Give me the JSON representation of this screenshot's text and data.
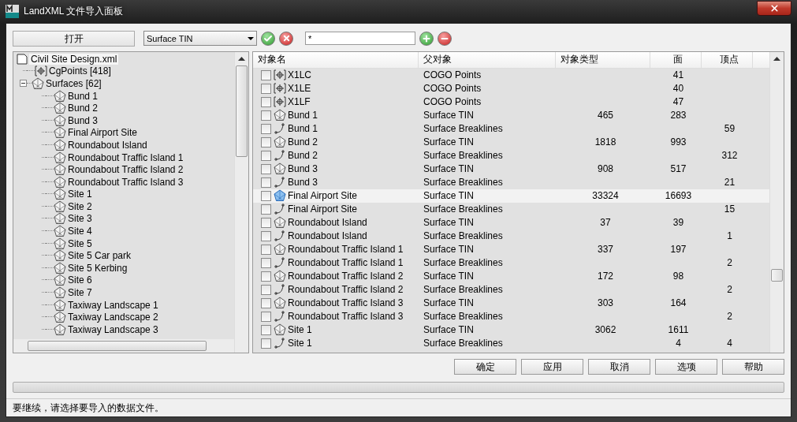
{
  "window": {
    "title": "LandXML 文件导入面板"
  },
  "toolbar": {
    "open_button": "打开",
    "filter_select": {
      "value": "Surface TIN"
    },
    "pattern_field": {
      "value": "*"
    }
  },
  "tree": [
    {
      "label": "Civil Site Design.xml",
      "kind": "file",
      "selected": true,
      "expanded": true,
      "children": [
        {
          "label": "CgPoints [418]",
          "kind": "points",
          "selected": false
        },
        {
          "label": "Surfaces [62]",
          "kind": "surface",
          "selected": false,
          "expanded": true,
          "children": [
            {
              "label": "Bund 1",
              "kind": "surface",
              "selected": false
            },
            {
              "label": "Bund 2",
              "kind": "surface",
              "selected": false
            },
            {
              "label": "Bund 3",
              "kind": "surface",
              "selected": false
            },
            {
              "label": "Final Airport Site",
              "kind": "surface",
              "selected": false
            },
            {
              "label": "Roundabout Island",
              "kind": "surface",
              "selected": false
            },
            {
              "label": "Roundabout Traffic Island 1",
              "kind": "surface",
              "selected": false
            },
            {
              "label": "Roundabout Traffic Island 2",
              "kind": "surface",
              "selected": false
            },
            {
              "label": "Roundabout Traffic Island 3",
              "kind": "surface",
              "selected": false
            },
            {
              "label": "Site 1",
              "kind": "surface",
              "selected": false
            },
            {
              "label": "Site 2",
              "kind": "surface",
              "selected": false
            },
            {
              "label": "Site 3",
              "kind": "surface",
              "selected": false
            },
            {
              "label": "Site 4",
              "kind": "surface",
              "selected": false
            },
            {
              "label": "Site 5",
              "kind": "surface",
              "selected": false
            },
            {
              "label": "Site 5 Car park",
              "kind": "surface",
              "selected": false
            },
            {
              "label": "Site 5 Kerbing",
              "kind": "surface",
              "selected": false
            },
            {
              "label": "Site 6",
              "kind": "surface",
              "selected": false
            },
            {
              "label": "Site 7",
              "kind": "surface",
              "selected": false
            },
            {
              "label": "Taxiway Landscape 1",
              "kind": "surface",
              "selected": false
            },
            {
              "label": "Taxiway Landscape 2",
              "kind": "surface",
              "selected": false
            },
            {
              "label": "Taxiway Landscape 3",
              "kind": "surface",
              "selected": false
            }
          ]
        }
      ]
    }
  ],
  "table": {
    "columns": [
      "对象名",
      "父对象",
      "对象类型",
      "面",
      "顶点"
    ],
    "rows": [
      {
        "kind": "points",
        "checked": false,
        "selected": false,
        "cells": [
          "X1LC",
          "COGO Points",
          "",
          "41",
          ""
        ]
      },
      {
        "kind": "points",
        "checked": false,
        "selected": false,
        "cells": [
          "X1LE",
          "COGO Points",
          "",
          "40",
          ""
        ]
      },
      {
        "kind": "points",
        "checked": false,
        "selected": false,
        "cells": [
          "X1LF",
          "COGO Points",
          "",
          "47",
          ""
        ]
      },
      {
        "kind": "tin",
        "checked": false,
        "selected": false,
        "cells": [
          "Bund 1",
          "Surface TIN",
          "465",
          "283",
          ""
        ]
      },
      {
        "kind": "breakline",
        "checked": false,
        "selected": false,
        "cells": [
          "Bund 1",
          "Surface Breaklines",
          "",
          "",
          "59"
        ]
      },
      {
        "kind": "tin",
        "checked": false,
        "selected": false,
        "cells": [
          "Bund 2",
          "Surface TIN",
          "1818",
          "993",
          ""
        ]
      },
      {
        "kind": "breakline",
        "checked": false,
        "selected": false,
        "cells": [
          "Bund 2",
          "Surface Breaklines",
          "",
          "",
          "312"
        ]
      },
      {
        "kind": "tin",
        "checked": false,
        "selected": false,
        "cells": [
          "Bund 3",
          "Surface TIN",
          "908",
          "517",
          ""
        ]
      },
      {
        "kind": "breakline",
        "checked": false,
        "selected": false,
        "cells": [
          "Bund 3",
          "Surface Breaklines",
          "",
          "",
          "21"
        ]
      },
      {
        "kind": "tin",
        "checked": false,
        "selected": true,
        "cells": [
          "Final Airport Site",
          "Surface TIN",
          "33324",
          "16693",
          ""
        ]
      },
      {
        "kind": "breakline",
        "checked": false,
        "selected": false,
        "cells": [
          "Final Airport Site",
          "Surface Breaklines",
          "",
          "",
          "15"
        ]
      },
      {
        "kind": "tin",
        "checked": false,
        "selected": false,
        "cells": [
          "Roundabout Island",
          "Surface TIN",
          "37",
          "39",
          ""
        ]
      },
      {
        "kind": "breakline",
        "checked": false,
        "selected": false,
        "cells": [
          "Roundabout Island",
          "Surface Breaklines",
          "",
          "",
          "1"
        ]
      },
      {
        "kind": "tin",
        "checked": false,
        "selected": false,
        "cells": [
          "Roundabout Traffic Island 1",
          "Surface TIN",
          "337",
          "197",
          ""
        ]
      },
      {
        "kind": "breakline",
        "checked": false,
        "selected": false,
        "cells": [
          "Roundabout Traffic Island 1",
          "Surface Breaklines",
          "",
          "",
          "2"
        ]
      },
      {
        "kind": "tin",
        "checked": false,
        "selected": false,
        "cells": [
          "Roundabout Traffic Island 2",
          "Surface TIN",
          "172",
          "98",
          ""
        ]
      },
      {
        "kind": "breakline",
        "checked": false,
        "selected": false,
        "cells": [
          "Roundabout Traffic Island 2",
          "Surface Breaklines",
          "",
          "",
          "2"
        ]
      },
      {
        "kind": "tin",
        "checked": false,
        "selected": false,
        "cells": [
          "Roundabout Traffic Island 3",
          "Surface TIN",
          "303",
          "164",
          ""
        ]
      },
      {
        "kind": "breakline",
        "checked": false,
        "selected": false,
        "cells": [
          "Roundabout Traffic Island 3",
          "Surface Breaklines",
          "",
          "",
          "2"
        ]
      },
      {
        "kind": "tin",
        "checked": false,
        "selected": false,
        "cells": [
          "Site 1",
          "Surface TIN",
          "3062",
          "1611",
          ""
        ]
      },
      {
        "kind": "breakline",
        "checked": false,
        "selected": false,
        "cells": [
          "Site 1",
          "Surface Breaklines",
          "",
          "4",
          "4"
        ]
      }
    ]
  },
  "buttons": [
    "确定",
    "应用",
    "取消",
    "选项",
    "帮助"
  ],
  "progress": {
    "level": 0
  },
  "status_bar": "要继续，请选择要导入的数据文件。"
}
